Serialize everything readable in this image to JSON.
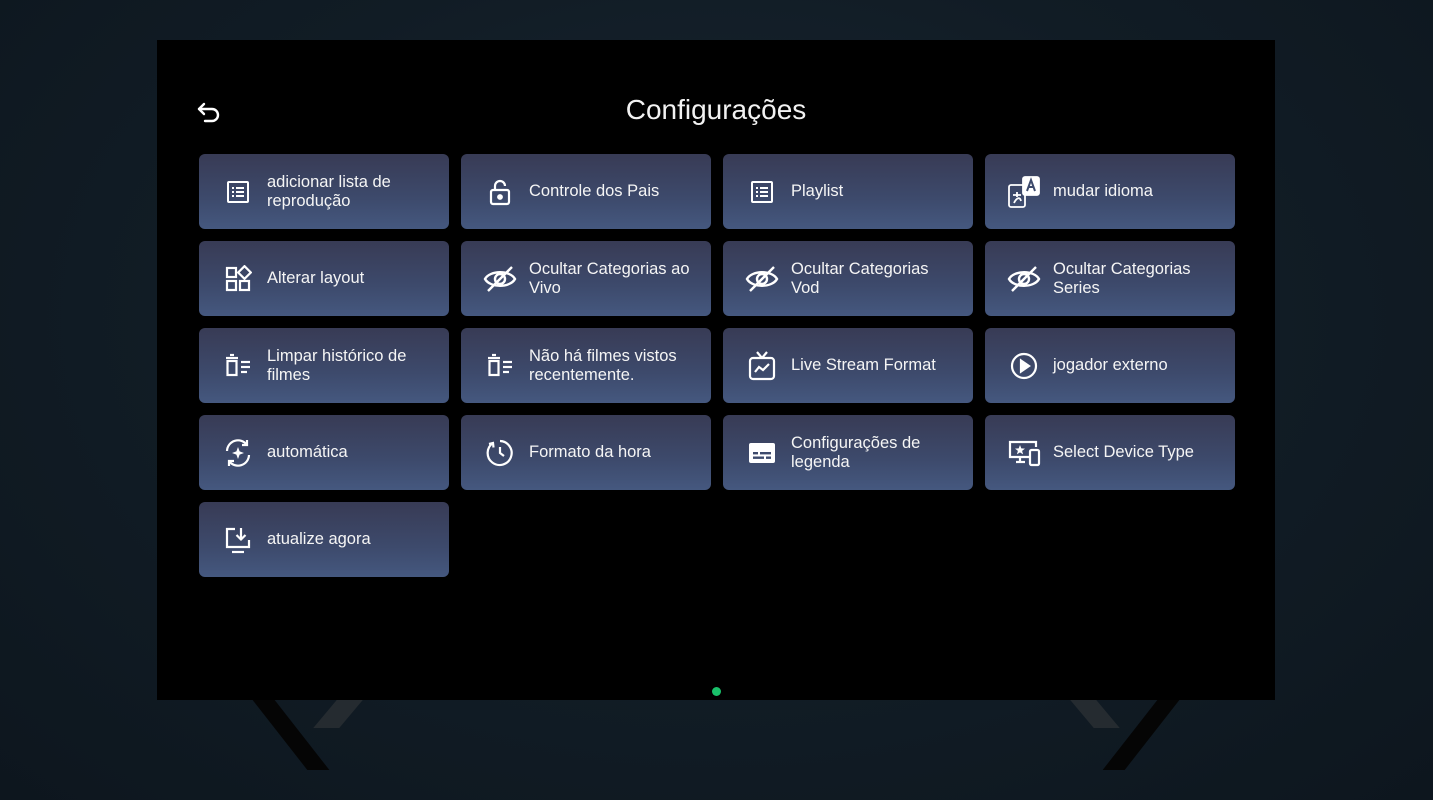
{
  "title": "Configurações",
  "accent_color": "#19c06a",
  "tile_color": "#3d4a6c",
  "back_icon": "back-arrow-icon",
  "tiles": [
    {
      "label": "adicionar lista de reprodução",
      "icon": "list-icon"
    },
    {
      "label": "Controle dos Pais",
      "icon": "lock-icon"
    },
    {
      "label": "Playlist",
      "icon": "list-icon"
    },
    {
      "label": "mudar idioma",
      "icon": "translate-icon"
    },
    {
      "label": "Alterar layout",
      "icon": "layout-icon"
    },
    {
      "label": "Ocultar Categorias ao Vivo",
      "icon": "eye-off-icon"
    },
    {
      "label": "Ocultar Categorias Vod",
      "icon": "eye-off-icon"
    },
    {
      "label": "Ocultar Categorias Series",
      "icon": "eye-off-icon"
    },
    {
      "label": "Limpar histórico de filmes",
      "icon": "clear-history-icon"
    },
    {
      "label": "Não há filmes vistos recentemente.",
      "icon": "clear-history-icon"
    },
    {
      "label": "Live Stream Format",
      "icon": "tv-icon"
    },
    {
      "label": "jogador externo",
      "icon": "play-circle-icon"
    },
    {
      "label": "automática",
      "icon": "auto-refresh-icon"
    },
    {
      "label": "Formato da hora",
      "icon": "clock-icon"
    },
    {
      "label": "Configurações de legenda",
      "icon": "subtitles-icon"
    },
    {
      "label": "Select Device Type",
      "icon": "device-icon"
    },
    {
      "label": "atualize agora",
      "icon": "download-icon"
    }
  ]
}
